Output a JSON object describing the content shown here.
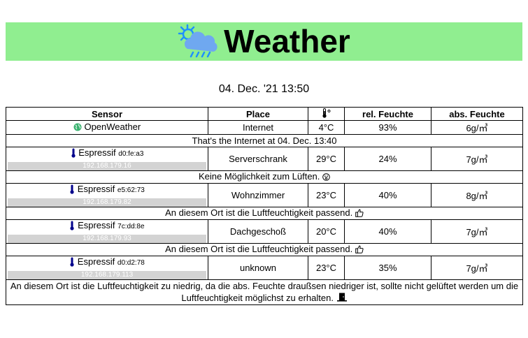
{
  "header": {
    "title": "Weather",
    "icon": "cloud-sun-rain-icon"
  },
  "datetime": "04. Dec. '21 13:50",
  "table": {
    "columns": {
      "sensor": "Sensor",
      "place": "Place",
      "temp_icon": "thermometer-icon",
      "temp_suffix": "°",
      "rel": "rel. Feuchte",
      "abs": "abs. Feuchte"
    },
    "openweather": {
      "name": "OpenWeather",
      "place": "Internet",
      "temp": "4°C",
      "rel": "93%",
      "abs": "6g/㎥",
      "message": "That's the Internet at 04. Dec. 13:40"
    },
    "rows": [
      {
        "name": "Espressif",
        "mac": "d0:fe:a3",
        "ip": "192.168.179.16",
        "place": "Serverschrank",
        "temp": "29°C",
        "rel": "24%",
        "abs": "7g/㎥",
        "message": "Keine Möglichkeit zum Lüften.",
        "message_icon": "smiley-icon"
      },
      {
        "name": "Espressif",
        "mac": "e5:62:73",
        "ip": "192.168.179.82",
        "place": "Wohnzimmer",
        "temp": "23°C",
        "rel": "40%",
        "abs": "8g/㎥",
        "message": "An diesem Ort ist die Luftfeuchtigkeit passend.",
        "message_icon": "thumbs-up-icon"
      },
      {
        "name": "Espressif",
        "mac": "7c:dd:8e",
        "ip": "192.168.179.93",
        "place": "Dachgeschoß",
        "temp": "20°C",
        "rel": "40%",
        "abs": "7g/㎥",
        "message": "An diesem Ort ist die Luftfeuchtigkeit passend.",
        "message_icon": "thumbs-up-icon"
      },
      {
        "name": "Espressif",
        "mac": "d0:d2:78",
        "ip": "192.168.179.113",
        "place": "unknown",
        "temp": "23°C",
        "rel": "35%",
        "abs": "7g/㎥",
        "message": "An diesem Ort ist die Luftfeuchtigkeit zu niedrig, da die abs. Feuchte draußsen niedriger ist, sollte nicht gelüftet werden um die Luftfeuchtigkeit möglichst zu erhalten.",
        "message_icon": "closed-door-icon"
      }
    ]
  },
  "colors": {
    "banner": "#90ee90",
    "ip_bar": "#d3d3d3",
    "thermometer": "#00008b",
    "globe": "#3cb371"
  }
}
